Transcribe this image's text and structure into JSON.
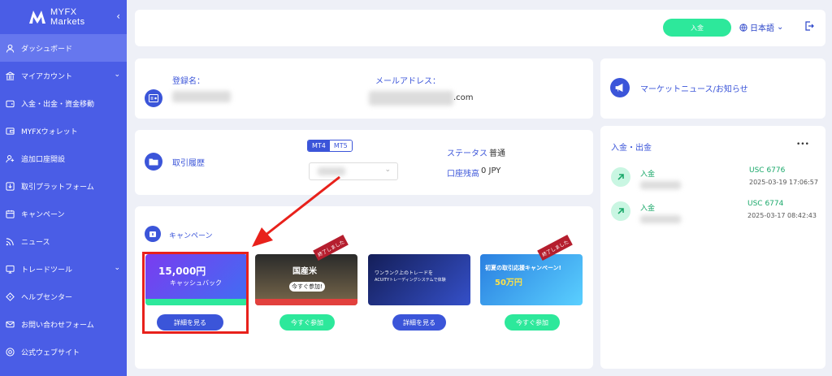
{
  "brand": {
    "name_line1": "MYFX",
    "name_line2": "Markets"
  },
  "sidebar": {
    "items": [
      {
        "label": "ダッシュボード",
        "icon": "user-icon",
        "active": true
      },
      {
        "label": "マイアカウント",
        "icon": "bank-icon",
        "has_chevron": true
      },
      {
        "label": "入金・出金・資金移動",
        "icon": "wallet-icon"
      },
      {
        "label": "MYFXウォレット",
        "icon": "wallet-icon"
      },
      {
        "label": "追加口座開設",
        "icon": "user-plus-icon"
      },
      {
        "label": "取引プラットフォーム",
        "icon": "download-icon"
      },
      {
        "label": "キャンペーン",
        "icon": "calendar-icon"
      },
      {
        "label": "ニュース",
        "icon": "rss-icon"
      },
      {
        "label": "トレードツール",
        "icon": "tools-icon",
        "has_chevron": true
      },
      {
        "label": "ヘルプセンター",
        "icon": "diamond-icon"
      },
      {
        "label": "お問い合わせフォーム",
        "icon": "mail-icon"
      },
      {
        "label": "公式ウェブサイト",
        "icon": "globe-icon"
      }
    ]
  },
  "header": {
    "deposit_label": "入金",
    "language": "日本語"
  },
  "profile": {
    "name_label": "登録名：",
    "email_label": "メールアドレス：",
    "email_suffix": ".com"
  },
  "trading": {
    "title": "取引履歴",
    "tab_mt4": "MT4",
    "tab_mt5": "MT5",
    "status_label": "ステータス",
    "status_value": "普通",
    "balance_label": "口座残高",
    "balance_value": "0 JPY"
  },
  "campaign": {
    "title": "キャンペーン",
    "ended_label": "終了しました",
    "banners": [
      {
        "text_big": "15,000円",
        "text_sub": "キャッシュバック",
        "button": "詳細を見る"
      },
      {
        "text_big": "国産米",
        "text_sub": "今すぐ参加!",
        "button": "今すぐ参加"
      },
      {
        "text_big": "ワンランク上のトレードを",
        "text_sub": "ACUITYトレーディングシステムで体験",
        "button": "詳細を見る"
      },
      {
        "text_big": "初夏の取引応援キャンペーン!",
        "text_sub": "50万円",
        "button": "今すぐ参加"
      }
    ]
  },
  "news": {
    "title": "マーケットニュース/お知らせ"
  },
  "transfers": {
    "title": "入金・出金",
    "more": "•••",
    "items": [
      {
        "type": "入金",
        "amount": "USC 6776",
        "date": "2025-03-19 17:06:57"
      },
      {
        "type": "入金",
        "amount": "USC 6774",
        "date": "2025-03-17 08:42:43"
      }
    ]
  },
  "colors": {
    "sidebar": "#4a5de6",
    "accent": "#3b55d9",
    "green": "#2de89b",
    "highlight": "#e8211b"
  }
}
